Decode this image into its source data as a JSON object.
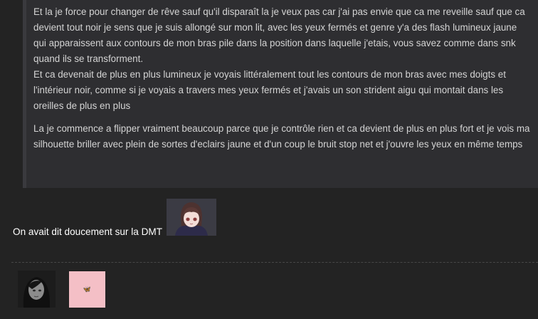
{
  "post": {
    "quote_paragraphs": [
      "Et la je force pour changer de rêve sauf qu'il disparaît la je veux pas car j'ai pas envie que ca me reveille sauf que ca devient tout noir je sens que je suis allongé sur mon lit, avec les yeux fermés et genre y'a des flash lumineux jaune qui apparaissent aux contours de mon bras pile dans la position dans laquelle j'etais, vous savez comme dans snk quand ils se transforment.",
      "Et ca devenait de plus en plus lumineux je voyais littéralement tout les contours de mon bras avec mes doigts et l'intérieur noir, comme si je voyais a travers mes yeux fermés et j'avais un son strident aigu qui montait dans les oreilles de plus en plus",
      "La je commence a flipper vraiment beaucoup parce que je contrôle rien et ca devient de plus en plus fort et je vois ma silhouette briller avec plein de sortes d'eclairs jaune et d'un coup le bruit stop net et j'ouvre les yeux en même temps"
    ],
    "reply_text": "On avait dit doucement sur la DMT",
    "sticker_icon": "anime-girl-sticker",
    "thumbnail_icon": "butterfly-icon",
    "butterfly_glyph": "🦋"
  },
  "colors": {
    "background": "#232323",
    "quote_background": "#2e2e31",
    "quote_text": "#d4d4d4",
    "reply_text": "#ffffff",
    "thumbnail_pink": "#f4bfc6"
  }
}
